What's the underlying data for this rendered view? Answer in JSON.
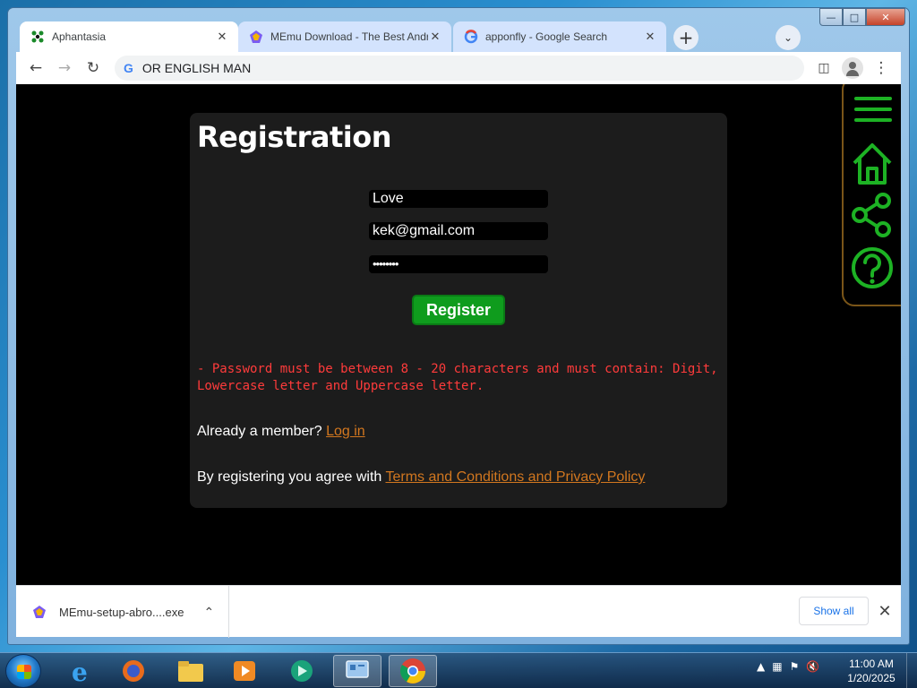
{
  "browser": {
    "tabs": [
      {
        "title": "Aphantasia",
        "active": true,
        "icon": "aphantasia-favicon"
      },
      {
        "title": "MEmu Download - The Best Andr",
        "active": false,
        "icon": "memu-favicon"
      },
      {
        "title": "apponfly - Google Search",
        "active": false,
        "icon": "google-favicon"
      }
    ],
    "tab_close": "✕",
    "new_tab": "+",
    "address": "OR ENGLISH MAN",
    "address_icon": "G"
  },
  "form": {
    "title": "Registration",
    "username": "Love",
    "email": "kek@gmail.com",
    "password_mask": "••••••••",
    "register_label": "Register",
    "error": "- Password must be between 8 - 20 characters and must contain: Digit, Lowercase letter and Uppercase letter.",
    "member_text": "Already a member?",
    "login_link": "Log in",
    "terms_text": "By registering you agree with",
    "terms_link": "Terms and Conditions and Privacy Policy"
  },
  "sidenav": [
    "menu-icon",
    "home-icon",
    "share-icon",
    "help-icon"
  ],
  "colors": {
    "accent_green": "#0f9c1d",
    "link_orange": "#d2771f",
    "error_red": "#ff3b3b",
    "nav_green": "#1db224"
  },
  "downloads": {
    "filename": "MEmu-setup-abro....exe",
    "show_all": "Show all"
  },
  "taskbar": {
    "apps": [
      "internet-explorer-icon",
      "firefox-icon",
      "file-explorer-icon",
      "media-player-icon",
      "app-icon",
      "control-panel-icon",
      "chrome-icon"
    ],
    "time": "11:00 AM",
    "date": "1/20/2025"
  }
}
